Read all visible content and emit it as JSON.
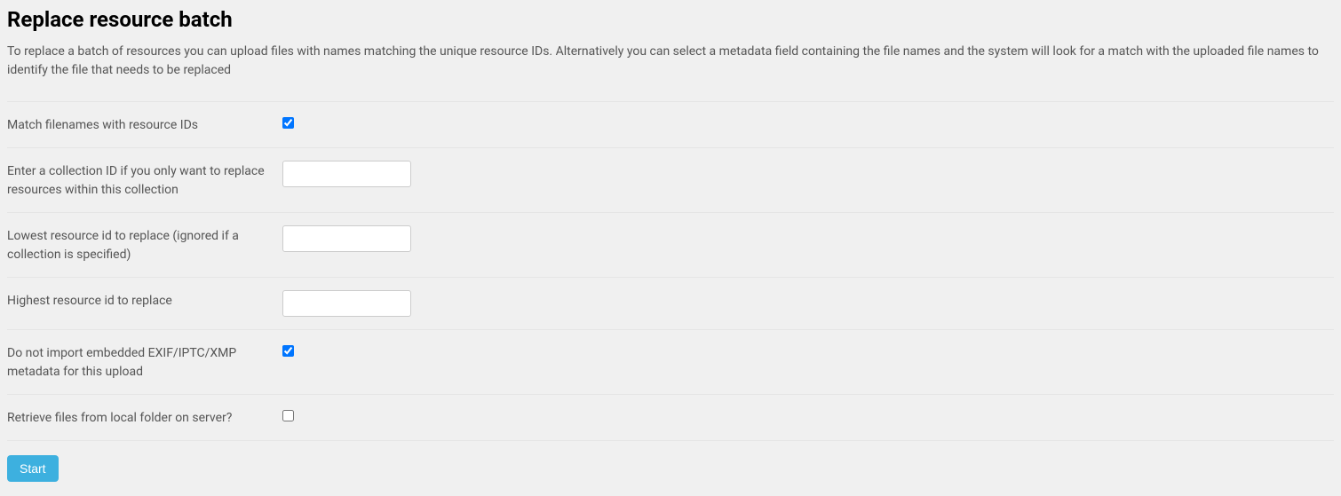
{
  "page": {
    "title": "Replace resource batch",
    "description": "To replace a batch of resources you can upload files with names matching the unique resource IDs. Alternatively you can select a metadata field containing the file names and the system will look for a match with the uploaded file names to identify the file that needs to be replaced"
  },
  "form": {
    "match_filenames": {
      "label": "Match filenames with resource IDs",
      "checked": true
    },
    "collection_id": {
      "label": "Enter a collection ID if you only want to replace resources within this collection",
      "value": ""
    },
    "lowest_resource_id": {
      "label": "Lowest resource id to replace (ignored if a collection is specified)",
      "value": ""
    },
    "highest_resource_id": {
      "label": "Highest resource id to replace",
      "value": ""
    },
    "no_import_metadata": {
      "label": "Do not import embedded EXIF/IPTC/XMP metadata for this upload",
      "checked": true
    },
    "retrieve_local": {
      "label": "Retrieve files from local folder on server?",
      "checked": false
    },
    "start_button_label": "Start"
  }
}
